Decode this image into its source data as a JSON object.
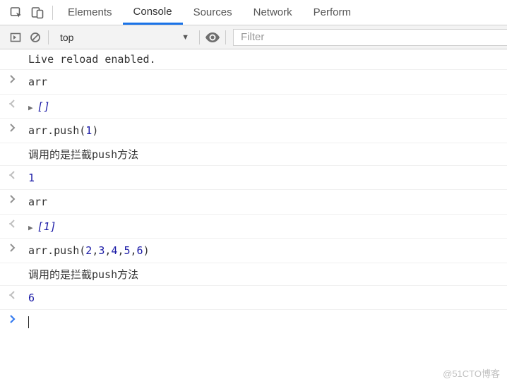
{
  "tabs": {
    "elements": "Elements",
    "console": "Console",
    "sources": "Sources",
    "network": "Network",
    "performance": "Perform"
  },
  "toolbar": {
    "context": "top",
    "filter_placeholder": "Filter"
  },
  "console_lines": {
    "live_reload": "Live reload enabled.",
    "input_arr1": "arr",
    "output_arr1": "[]",
    "input_push1_pre": "arr.push(",
    "input_push1_arg": "1",
    "input_push1_post": ")",
    "log_intercept1": "调用的是拦截push方法",
    "output_push1": "1",
    "input_arr2": "arr",
    "output_arr2": "[1]",
    "input_push2_pre": "arr.push(",
    "input_push2_args": [
      "2",
      "3",
      "4",
      "5",
      "6"
    ],
    "input_push2_post": ")",
    "log_intercept2": "调用的是拦截push方法",
    "output_push2": "6"
  },
  "watermark": "@51CTO博客"
}
